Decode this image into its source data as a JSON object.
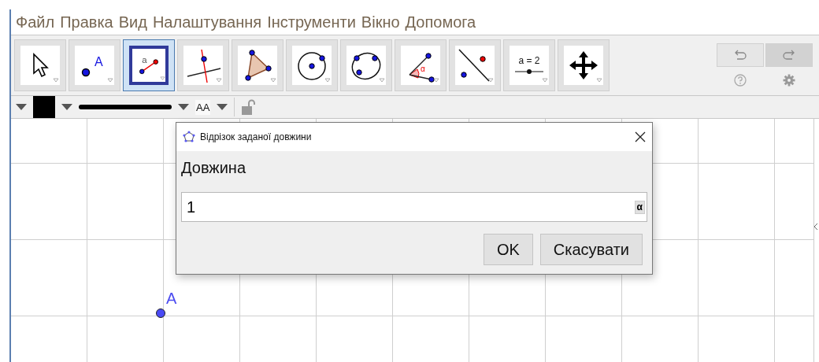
{
  "menu": [
    "Файл",
    "Правка",
    "Вид",
    "Налаштування",
    "Інструменти",
    "Вікно",
    "Допомога"
  ],
  "toolbar": {
    "tools": [
      {
        "kind": "move",
        "selected": false
      },
      {
        "kind": "point",
        "label": "A",
        "selected": false
      },
      {
        "kind": "segment",
        "label": "a",
        "selected": true
      },
      {
        "kind": "perpendicular",
        "selected": false
      },
      {
        "kind": "polygon",
        "selected": false
      },
      {
        "kind": "circle",
        "selected": false
      },
      {
        "kind": "conic",
        "selected": false
      },
      {
        "kind": "angle",
        "label": "α",
        "selected": false
      },
      {
        "kind": "reflect",
        "selected": false
      },
      {
        "kind": "slider",
        "label": "a = 2",
        "selected": false
      },
      {
        "kind": "pan",
        "selected": false
      }
    ]
  },
  "style_bar": {
    "text_size": "AA"
  },
  "canvas": {
    "points": [
      {
        "label": "A"
      }
    ]
  },
  "dialog": {
    "title": "Відрізок заданої довжини",
    "label": "Довжина",
    "input": {
      "value": "1"
    },
    "symbol_button": "α",
    "buttons": [
      "OK",
      "Скасувати"
    ]
  }
}
